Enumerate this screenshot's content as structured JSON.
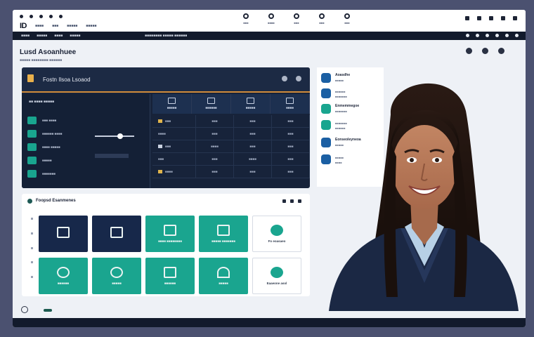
{
  "top": {
    "brand": "ID",
    "nav": [
      "■■■■",
      "■■■",
      "■■■■■",
      "■■■■■"
    ],
    "center_icons": [
      {
        "icon": "clock-icon",
        "label": "■■■"
      },
      {
        "icon": "user-icon",
        "label": "■■■■"
      },
      {
        "icon": "tag-icon",
        "label": "■■■"
      },
      {
        "icon": "camera-icon",
        "label": "■■■"
      },
      {
        "icon": "megaphone-icon",
        "label": "■■■"
      }
    ]
  },
  "navbar": {
    "left": [
      "■■■■",
      "■■■■■",
      "■■■■",
      "■■■■■"
    ],
    "mid": "■■■■■■■■ ■■■■■ ■■■■■■"
  },
  "page": {
    "title": "Lusd Asoanhuee",
    "subtitle": "■■■■■ ■■■■■■■■ ■■■■■■"
  },
  "dashboard": {
    "title": "Fostn Ilsoa Lsoaod",
    "left_title": "■■ ■■■■ ■■■■■",
    "left_items": [
      "■■■ ■■■■",
      "■■■■■■ ■■■■",
      "■■■■ ■■■■■",
      "■■■■■",
      "■■■■■■■"
    ],
    "slider_level": 0.65,
    "columns": [
      {
        "icon": "document-icon",
        "label": "■■■■■"
      },
      {
        "icon": "laptop-icon",
        "label": "■■■■■■"
      },
      {
        "icon": "chart-icon",
        "label": "■■■■■"
      },
      {
        "icon": "person-icon",
        "label": "■■■■"
      }
    ],
    "rows": [
      [
        "■■■",
        "■■■",
        "■■■",
        "■■■"
      ],
      [
        "■■■■",
        "■■■",
        "■■■",
        "■■■"
      ],
      [
        "■■■",
        "■■■■",
        "■■■",
        "■■■"
      ],
      [
        "■■■",
        "■■■",
        "■■■■",
        "■■■"
      ],
      [
        "■■■■",
        "■■■",
        "■■■",
        "■■■"
      ]
    ]
  },
  "tiles": {
    "title": "Foopsd Esanmenes",
    "items": [
      {
        "style": "navy",
        "icon": "folder-icon",
        "label": ""
      },
      {
        "style": "navy",
        "icon": "check-icon",
        "label": ""
      },
      {
        "style": "teal",
        "icon": "image-icon",
        "label": "■■■■ ■■■■■■■■"
      },
      {
        "style": "teal",
        "icon": "screen-icon",
        "label": "■■■■■ ■■■■■■■"
      },
      {
        "style": "white",
        "icon": "leaf-icon",
        "label": "Fo eoasaeo"
      },
      {
        "style": "teal",
        "icon": "globe-icon",
        "label": "■■■■■■"
      },
      {
        "style": "teal",
        "icon": "person-icon",
        "label": "■■■■■"
      },
      {
        "style": "teal",
        "icon": "clipboard-icon",
        "label": "■■■■■■"
      },
      {
        "style": "teal",
        "icon": "trend-icon",
        "label": "■■■■■"
      },
      {
        "style": "white",
        "icon": "badge-icon",
        "label": "Eaaeone asol"
      }
    ]
  },
  "sidebar": {
    "items": [
      {
        "icon": "calendar-icon",
        "title": "Aoasdhe",
        "desc": "■■■■■"
      },
      {
        "icon": "bell-icon",
        "title": "■■■■■■",
        "desc": "■■■■■■■"
      },
      {
        "icon": "book-icon",
        "title": "Enmemmegoe",
        "desc": "■■■■■■■"
      },
      {
        "icon": "grad-cap-icon",
        "title": "■■■■■■■",
        "desc": "■■■■■■"
      },
      {
        "icon": "user-icon",
        "title": "Eonseoleyneoa",
        "desc": "■■■■■"
      },
      {
        "icon": "globe-icon",
        "title": "■■■■■",
        "desc": "■■■■"
      }
    ]
  },
  "colors": {
    "accent_teal": "#1aa58f",
    "navy": "#17233a",
    "orange_rule": "#d08b3a",
    "page_bg": "#eef1f6"
  }
}
